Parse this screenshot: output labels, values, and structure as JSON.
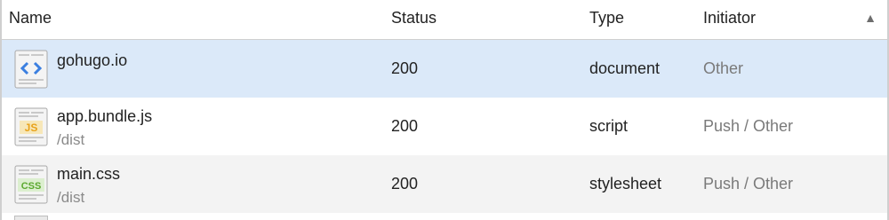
{
  "columns": {
    "name": "Name",
    "status": "Status",
    "type": "Type",
    "initiator": "Initiator"
  },
  "sort": {
    "column": "Initiator",
    "direction": "ascending",
    "icon": "triangle-up-icon"
  },
  "rows": [
    {
      "name": "gohugo.io",
      "path": "",
      "status": "200",
      "type": "document",
      "initiator": "Other",
      "icon": "html-document-icon",
      "icon_label": "<>",
      "icon_color": "#3b7fe0",
      "selected": true
    },
    {
      "name": "app.bundle.js",
      "path": "/dist",
      "status": "200",
      "type": "script",
      "initiator": "Push / Other",
      "icon": "javascript-file-icon",
      "icon_label": "JS",
      "icon_color": "#e8a21a",
      "selected": false
    },
    {
      "name": "main.css",
      "path": "/dist",
      "status": "200",
      "type": "stylesheet",
      "initiator": "Push / Other",
      "icon": "css-file-icon",
      "icon_label": "CSS",
      "icon_color": "#5aa82e",
      "selected": false
    }
  ],
  "colors": {
    "selected_row": "#dbe9f9",
    "alt_row": "#f3f3f3",
    "muted_text": "#7a7a7a"
  }
}
